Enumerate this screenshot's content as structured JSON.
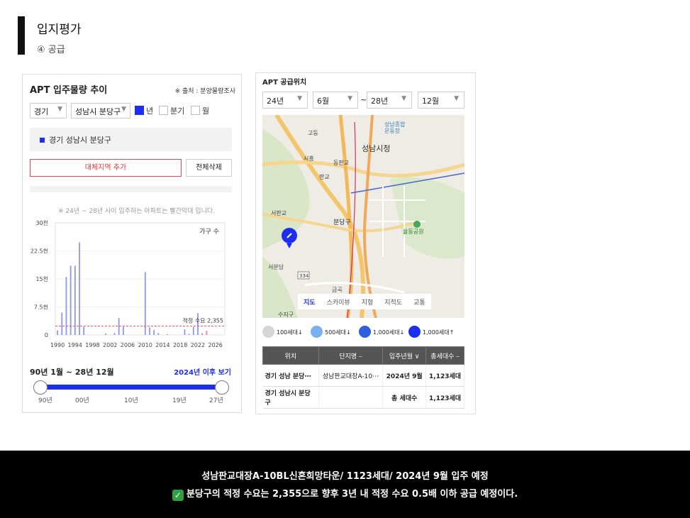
{
  "header": {
    "title": "입지평가",
    "subtitle": "④ 공급"
  },
  "left_panel": {
    "title": "APT 입주물량 추이",
    "source": "※ 출처 : 분양물량조사",
    "province": "경기",
    "district": "성남시 분당구",
    "period_options": [
      {
        "label": "년",
        "checked": true
      },
      {
        "label": "분기",
        "checked": false
      },
      {
        "label": "월",
        "checked": false
      }
    ],
    "region_label": "경기 성남시 분당구",
    "add_button": "대체지역 추가",
    "delete_button": "전체삭제",
    "chart_note": "※ 24년 ~ 28년 사이 입주하는 아파트는 빨간막대 입니다.",
    "range_title": "90년 1월 ~ 28년 12월",
    "range_link": "2024년 이후 보기",
    "slider_labels": [
      "90년",
      "00년",
      "10년",
      "19년",
      "27년"
    ]
  },
  "chart_data": {
    "type": "bar",
    "ylabel": "가구 수",
    "ylim": [
      0,
      30000
    ],
    "y_ticks": [
      "0",
      "7.5천",
      "15천",
      "22.5천",
      "30천"
    ],
    "x_ticks": [
      "1990",
      "1994",
      "1998",
      "2002",
      "2006",
      "2010",
      "2014",
      "2018",
      "2022",
      "2026"
    ],
    "reference_line": {
      "label": "적정 수요 2,355",
      "value": 2355
    },
    "categories": [
      "1990",
      "1991",
      "1992",
      "1993",
      "1994",
      "1995",
      "1996",
      "1997",
      "1998",
      "1999",
      "2000",
      "2001",
      "2002",
      "2003",
      "2004",
      "2005",
      "2006",
      "2007",
      "2008",
      "2009",
      "2010",
      "2011",
      "2012",
      "2013",
      "2014",
      "2015",
      "2016",
      "2017",
      "2018",
      "2019",
      "2020",
      "2021",
      "2022",
      "2023",
      "2024",
      "2025",
      "2026",
      "2027",
      "2028"
    ],
    "values": [
      1200,
      6000,
      15500,
      18500,
      18500,
      24800,
      2200,
      0,
      0,
      0,
      0,
      400,
      0,
      500,
      4500,
      2200,
      0,
      0,
      0,
      0,
      16800,
      2000,
      1300,
      500,
      0,
      200,
      0,
      0,
      0,
      1500,
      300,
      2200,
      5800,
      500,
      1123,
      0,
      0,
      0,
      0
    ],
    "highlight_from": "2024",
    "colors": {
      "bar": "#8f95f2",
      "highlight": "#f28c8c",
      "reference": "#e55555"
    }
  },
  "right_panel": {
    "title": "APT 공급위치",
    "from_year": "24년",
    "from_month": "6월",
    "tilde": "~",
    "to_year": "28년",
    "to_month": "12월",
    "map_labels": [
      "고등",
      "성남종합",
      "운동장",
      "성남시청",
      "시흥",
      "동판교",
      "판교",
      "서판교",
      "분당구",
      "율동공원",
      "서분당",
      "334",
      "금곡",
      "수지구"
    ],
    "map_tabs": [
      "지도",
      "스카이뷰",
      "지형",
      "지적도",
      "교통"
    ],
    "legend": [
      "100세대↓",
      "500세대↓",
      "1,000세대↓",
      "1,000세대↑"
    ],
    "table_headers": [
      "위치",
      "단지명 ⎯",
      "입주년월 ∨",
      "총세대수 ⎯"
    ],
    "rows": [
      [
        "경기 성남 분당⋯",
        "성남판교대장A-10⋯",
        "2024년 9월",
        "1,123세대"
      ],
      [
        "경기 성남시 분당구",
        "",
        "총 세대수",
        "1,123세대"
      ]
    ]
  },
  "footer": {
    "line1": "성남판교대장A-10BL신혼희망타운/ 1123세대/ 2024년 9월 입주 예정",
    "line2": "분당구의 적정 수요는 2,355으로 향후 3년 내 적정 수요 0.5배 이하 공급 예정이다."
  }
}
